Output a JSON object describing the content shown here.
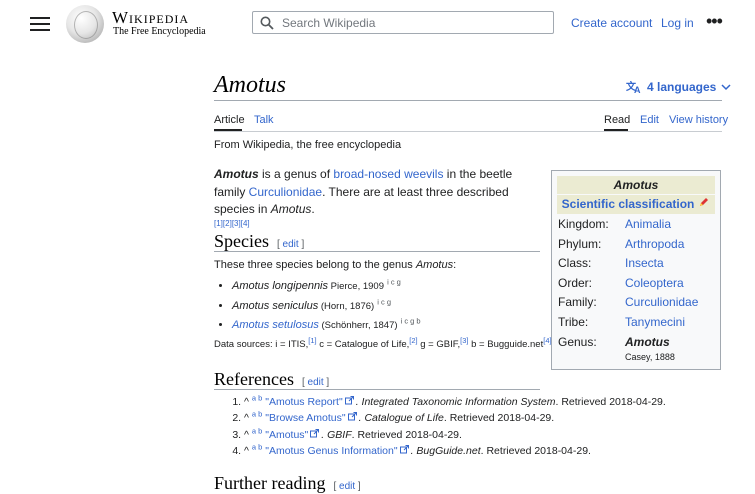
{
  "header": {
    "menu_icon": "hamburger-icon",
    "wordmark": "Wikipedia",
    "tagline": "The Free Encyclopedia",
    "search_placeholder": "Search Wikipedia",
    "create_account": "Create account",
    "log_in": "Log in",
    "more_icon": "ellipsis-icon"
  },
  "page": {
    "title": "Amotus",
    "languages": "4 languages",
    "tabs_left": [
      "Article",
      "Talk"
    ],
    "tabs_right": [
      "Read",
      "Edit",
      "View history"
    ],
    "from": "From Wikipedia, the free encyclopedia"
  },
  "intro": {
    "genus": "Amotus",
    "t1": " is a genus of ",
    "link1": "broad-nosed weevils",
    "t2": " in the beetle family ",
    "link2": "Curculionidae",
    "t3": ". There are at least three described species in ",
    "genus2": "Amotus",
    "t4": ".",
    "refs": [
      "[1]",
      "[2]",
      "[3]",
      "[4]"
    ]
  },
  "infobox": {
    "title": "Amotus",
    "classification": "Scientific classification",
    "rows": [
      {
        "label": "Kingdom:",
        "value": "Animalia"
      },
      {
        "label": "Phylum:",
        "value": "Arthropoda"
      },
      {
        "label": "Class:",
        "value": "Insecta"
      },
      {
        "label": "Order:",
        "value": "Coleoptera"
      },
      {
        "label": "Family:",
        "value": "Curculionidae"
      },
      {
        "label": "Tribe:",
        "value": "Tanymecini"
      }
    ],
    "genus_label": "Genus:",
    "genus_value": "Amotus",
    "genus_author": "Casey, 1888"
  },
  "species": {
    "heading": "Species",
    "edit": "edit",
    "intro_text": "These three species belong to the genus ",
    "intro_genus": "Amotus",
    "intro_end": ":",
    "items": [
      {
        "name": "Amotus longipennis",
        "author": " Pierce, 1909",
        "sources": "i c g"
      },
      {
        "name": "Amotus seniculus",
        "author": " (Horn, 1876)",
        "sources": "i c g"
      },
      {
        "name": "Amotus setulosus",
        "author": " (Schönherr, 1847)",
        "sources": "i c g b"
      }
    ],
    "ds_1": "Data sources: i = ITIS,",
    "ds_r1": "[1]",
    "ds_2": " c = Catalogue of Life,",
    "ds_r2": "[2]",
    "ds_3": " g = GBIF,",
    "ds_r3": "[3]",
    "ds_4": " b = Bugguide.net",
    "ds_r4": "[4]"
  },
  "references": {
    "heading": "References",
    "edit": "edit",
    "items": [
      {
        "caret": "^",
        "ab": "a b",
        "link": "\"Amotus Report\"",
        "rest": ". Integrated Taxonomic Information System",
        "date": ". Retrieved 2018-04-29."
      },
      {
        "caret": "^",
        "ab": "a b",
        "link": "\"Browse Amotus\"",
        "rest": ". Catalogue of Life",
        "date": ". Retrieved 2018-04-29."
      },
      {
        "caret": "^",
        "ab": "a b",
        "link": "\"Amotus\"",
        "rest": ". GBIF",
        "date": ". Retrieved 2018-04-29."
      },
      {
        "caret": "^",
        "ab": "a b",
        "link": "\"Amotus Genus Information\"",
        "rest": ". BugGuide.net",
        "date": ". Retrieved 2018-04-29."
      }
    ]
  },
  "further_reading": {
    "heading": "Further reading",
    "edit": "edit"
  },
  "colors": {
    "link": "#3366cc",
    "infobox_header": "#ebebd2"
  }
}
